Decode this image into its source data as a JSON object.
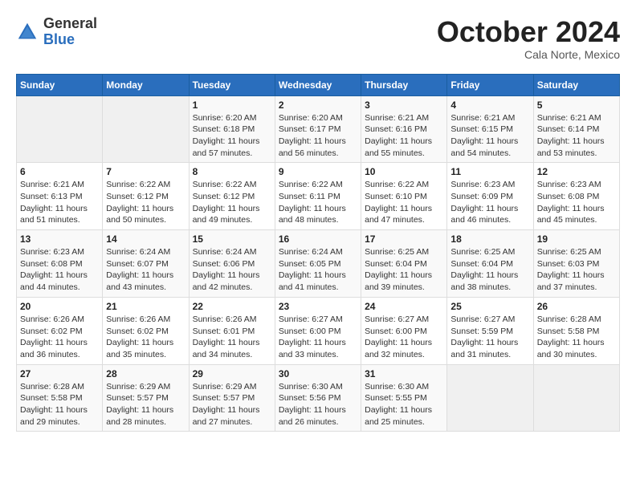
{
  "header": {
    "logo_general": "General",
    "logo_blue": "Blue",
    "month_title": "October 2024",
    "subtitle": "Cala Norte, Mexico"
  },
  "days_of_week": [
    "Sunday",
    "Monday",
    "Tuesday",
    "Wednesday",
    "Thursday",
    "Friday",
    "Saturday"
  ],
  "weeks": [
    [
      {
        "day": "",
        "info": ""
      },
      {
        "day": "",
        "info": ""
      },
      {
        "day": "1",
        "info": "Sunrise: 6:20 AM\nSunset: 6:18 PM\nDaylight: 11 hours and 57 minutes."
      },
      {
        "day": "2",
        "info": "Sunrise: 6:20 AM\nSunset: 6:17 PM\nDaylight: 11 hours and 56 minutes."
      },
      {
        "day": "3",
        "info": "Sunrise: 6:21 AM\nSunset: 6:16 PM\nDaylight: 11 hours and 55 minutes."
      },
      {
        "day": "4",
        "info": "Sunrise: 6:21 AM\nSunset: 6:15 PM\nDaylight: 11 hours and 54 minutes."
      },
      {
        "day": "5",
        "info": "Sunrise: 6:21 AM\nSunset: 6:14 PM\nDaylight: 11 hours and 53 minutes."
      }
    ],
    [
      {
        "day": "6",
        "info": "Sunrise: 6:21 AM\nSunset: 6:13 PM\nDaylight: 11 hours and 51 minutes."
      },
      {
        "day": "7",
        "info": "Sunrise: 6:22 AM\nSunset: 6:12 PM\nDaylight: 11 hours and 50 minutes."
      },
      {
        "day": "8",
        "info": "Sunrise: 6:22 AM\nSunset: 6:12 PM\nDaylight: 11 hours and 49 minutes."
      },
      {
        "day": "9",
        "info": "Sunrise: 6:22 AM\nSunset: 6:11 PM\nDaylight: 11 hours and 48 minutes."
      },
      {
        "day": "10",
        "info": "Sunrise: 6:22 AM\nSunset: 6:10 PM\nDaylight: 11 hours and 47 minutes."
      },
      {
        "day": "11",
        "info": "Sunrise: 6:23 AM\nSunset: 6:09 PM\nDaylight: 11 hours and 46 minutes."
      },
      {
        "day": "12",
        "info": "Sunrise: 6:23 AM\nSunset: 6:08 PM\nDaylight: 11 hours and 45 minutes."
      }
    ],
    [
      {
        "day": "13",
        "info": "Sunrise: 6:23 AM\nSunset: 6:08 PM\nDaylight: 11 hours and 44 minutes."
      },
      {
        "day": "14",
        "info": "Sunrise: 6:24 AM\nSunset: 6:07 PM\nDaylight: 11 hours and 43 minutes."
      },
      {
        "day": "15",
        "info": "Sunrise: 6:24 AM\nSunset: 6:06 PM\nDaylight: 11 hours and 42 minutes."
      },
      {
        "day": "16",
        "info": "Sunrise: 6:24 AM\nSunset: 6:05 PM\nDaylight: 11 hours and 41 minutes."
      },
      {
        "day": "17",
        "info": "Sunrise: 6:25 AM\nSunset: 6:04 PM\nDaylight: 11 hours and 39 minutes."
      },
      {
        "day": "18",
        "info": "Sunrise: 6:25 AM\nSunset: 6:04 PM\nDaylight: 11 hours and 38 minutes."
      },
      {
        "day": "19",
        "info": "Sunrise: 6:25 AM\nSunset: 6:03 PM\nDaylight: 11 hours and 37 minutes."
      }
    ],
    [
      {
        "day": "20",
        "info": "Sunrise: 6:26 AM\nSunset: 6:02 PM\nDaylight: 11 hours and 36 minutes."
      },
      {
        "day": "21",
        "info": "Sunrise: 6:26 AM\nSunset: 6:02 PM\nDaylight: 11 hours and 35 minutes."
      },
      {
        "day": "22",
        "info": "Sunrise: 6:26 AM\nSunset: 6:01 PM\nDaylight: 11 hours and 34 minutes."
      },
      {
        "day": "23",
        "info": "Sunrise: 6:27 AM\nSunset: 6:00 PM\nDaylight: 11 hours and 33 minutes."
      },
      {
        "day": "24",
        "info": "Sunrise: 6:27 AM\nSunset: 6:00 PM\nDaylight: 11 hours and 32 minutes."
      },
      {
        "day": "25",
        "info": "Sunrise: 6:27 AM\nSunset: 5:59 PM\nDaylight: 11 hours and 31 minutes."
      },
      {
        "day": "26",
        "info": "Sunrise: 6:28 AM\nSunset: 5:58 PM\nDaylight: 11 hours and 30 minutes."
      }
    ],
    [
      {
        "day": "27",
        "info": "Sunrise: 6:28 AM\nSunset: 5:58 PM\nDaylight: 11 hours and 29 minutes."
      },
      {
        "day": "28",
        "info": "Sunrise: 6:29 AM\nSunset: 5:57 PM\nDaylight: 11 hours and 28 minutes."
      },
      {
        "day": "29",
        "info": "Sunrise: 6:29 AM\nSunset: 5:57 PM\nDaylight: 11 hours and 27 minutes."
      },
      {
        "day": "30",
        "info": "Sunrise: 6:30 AM\nSunset: 5:56 PM\nDaylight: 11 hours and 26 minutes."
      },
      {
        "day": "31",
        "info": "Sunrise: 6:30 AM\nSunset: 5:55 PM\nDaylight: 11 hours and 25 minutes."
      },
      {
        "day": "",
        "info": ""
      },
      {
        "day": "",
        "info": ""
      }
    ]
  ]
}
